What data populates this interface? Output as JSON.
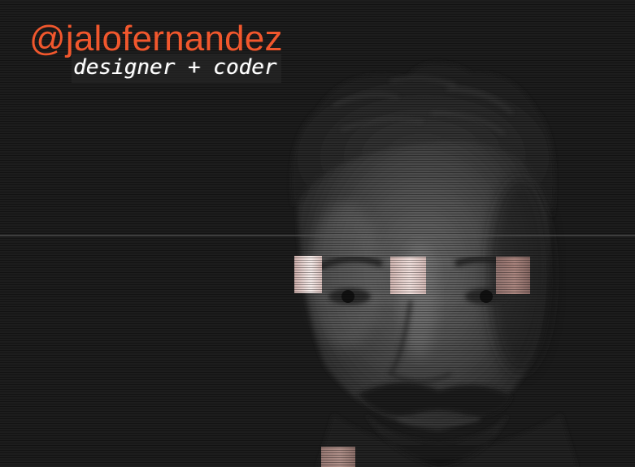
{
  "header": {
    "handle": "@jalofernandez",
    "tagline": "designer + coder"
  },
  "colors": {
    "accent": "#f1572d",
    "background": "#1d1d1d",
    "tagline_text": "#ffffff"
  },
  "portrait": {
    "icon": "portrait-photo"
  }
}
